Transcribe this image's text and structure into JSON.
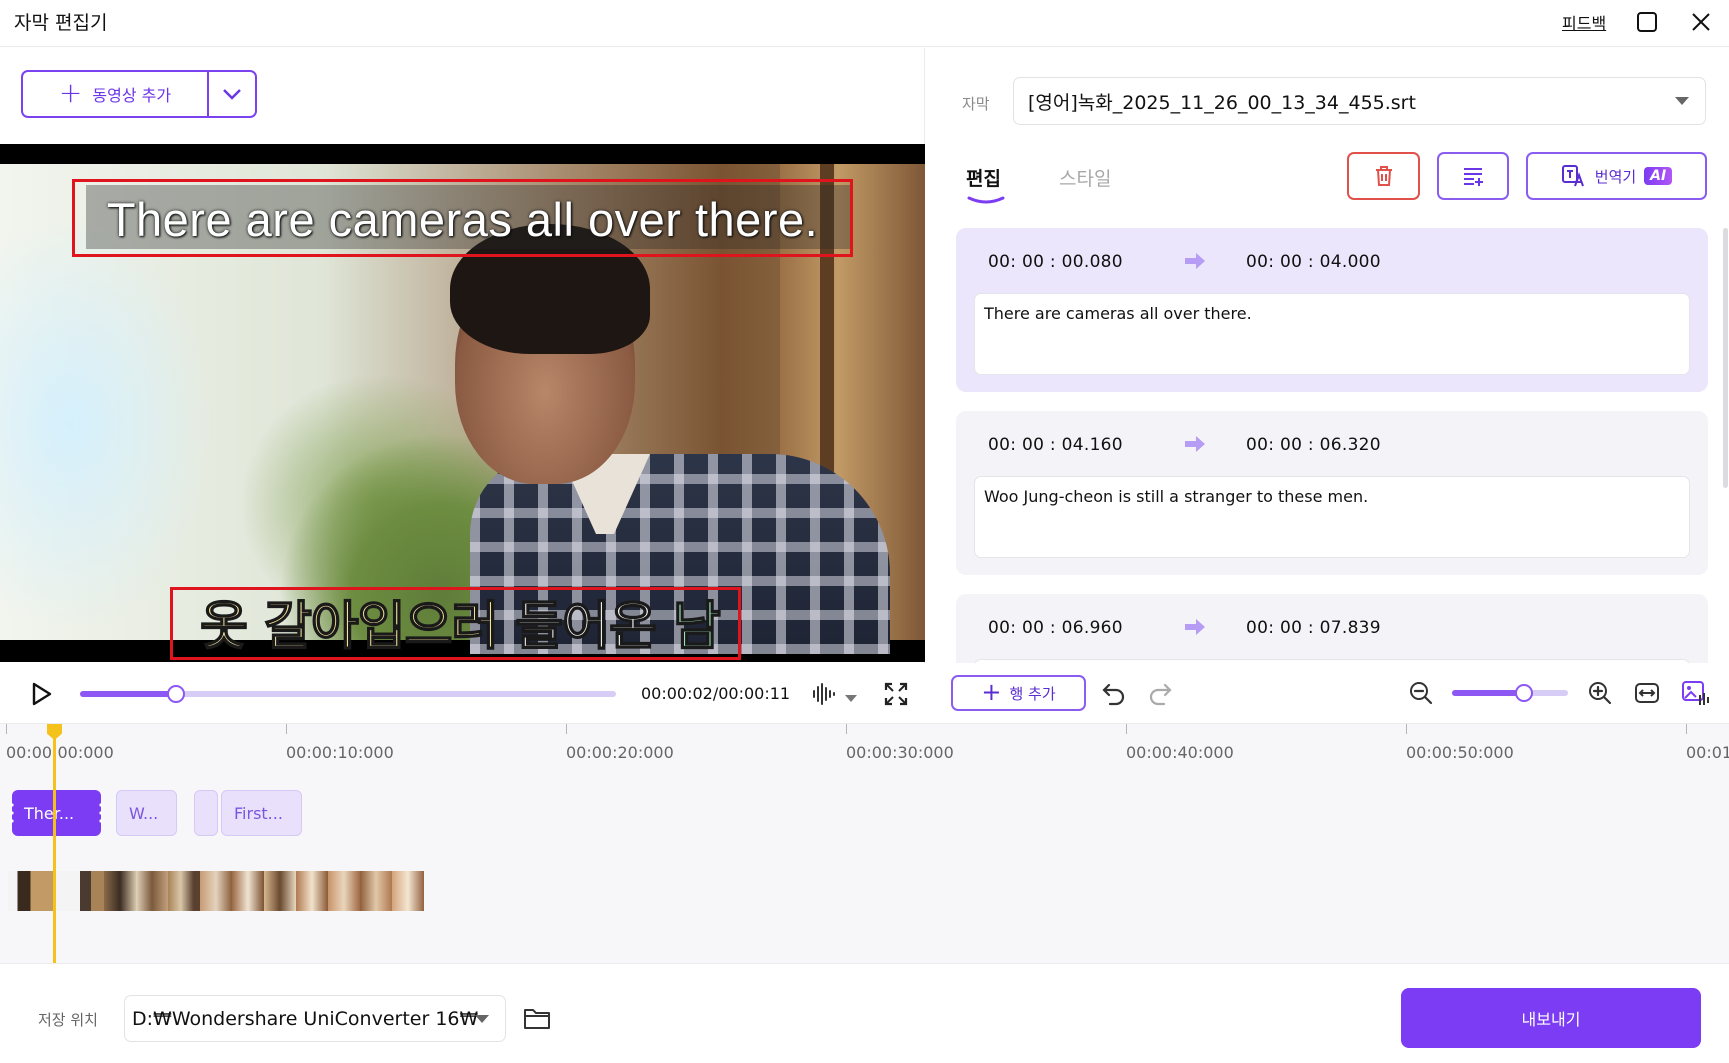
{
  "window": {
    "title": "자막 편집기",
    "feedback_label": "피드백",
    "maximize_icon": "maximize-icon",
    "close_icon": "close-icon"
  },
  "toolbar": {
    "add_video_label": "동영상 추가",
    "add_video_dropdown_icon": "chevron-down-icon"
  },
  "preview": {
    "subtitle_en": "There are cameras all over there.",
    "subtitle_ko_parts": [
      "옷 갈아입으러",
      "들어온",
      "남자들"
    ],
    "highlight_color": "#e0141c"
  },
  "player": {
    "time_current": "00:00:02",
    "time_total": "00:00:11",
    "time_display": "00:00:02/00:00:11",
    "progress_fraction": 0.18
  },
  "subtitle_panel": {
    "label": "자막",
    "selected_file": "[영어]녹화_2025_11_26_00_13_34_455.srt",
    "tabs": [
      {
        "label": "편집",
        "active": true
      },
      {
        "label": "스타일",
        "active": false
      }
    ],
    "translate_label": "번역기",
    "ai_badge": "AI",
    "entries": [
      {
        "start": "00: 00 : 00.080",
        "end": "00: 00 : 04.000",
        "text": "There are cameras all over there.",
        "active": true
      },
      {
        "start": "00: 00 : 04.160",
        "end": "00: 00 : 06.320",
        "text": "Woo Jung-cheon is still a stranger to these men.",
        "active": false
      },
      {
        "start": "00: 00 : 06.960",
        "end": "00: 00 : 07.839",
        "text": "",
        "active": false
      }
    ]
  },
  "edit_tools": {
    "add_row_label": "행 추가",
    "zoom_fraction": 0.62
  },
  "timeline": {
    "ticks": [
      "00:00:00:000",
      "00:00:10:000",
      "00:00:20:000",
      "00:00:30:000",
      "00:00:40:000",
      "00:00:50:000",
      "00:01"
    ],
    "clips": [
      {
        "label": "Ther...",
        "selected": true
      },
      {
        "label": "W...",
        "selected": false
      },
      {
        "label": "",
        "selected": false
      },
      {
        "label": "First...",
        "selected": false
      }
    ]
  },
  "footer": {
    "save_location_label": "저장 위치",
    "save_path": "D:₩Wondershare UniConverter 16₩",
    "export_label": "내보내기"
  },
  "colors": {
    "accent": "#7b3cf3",
    "accent_light": "#d7ccf6",
    "delete": "#e1514c",
    "playhead": "#f4c21a"
  }
}
